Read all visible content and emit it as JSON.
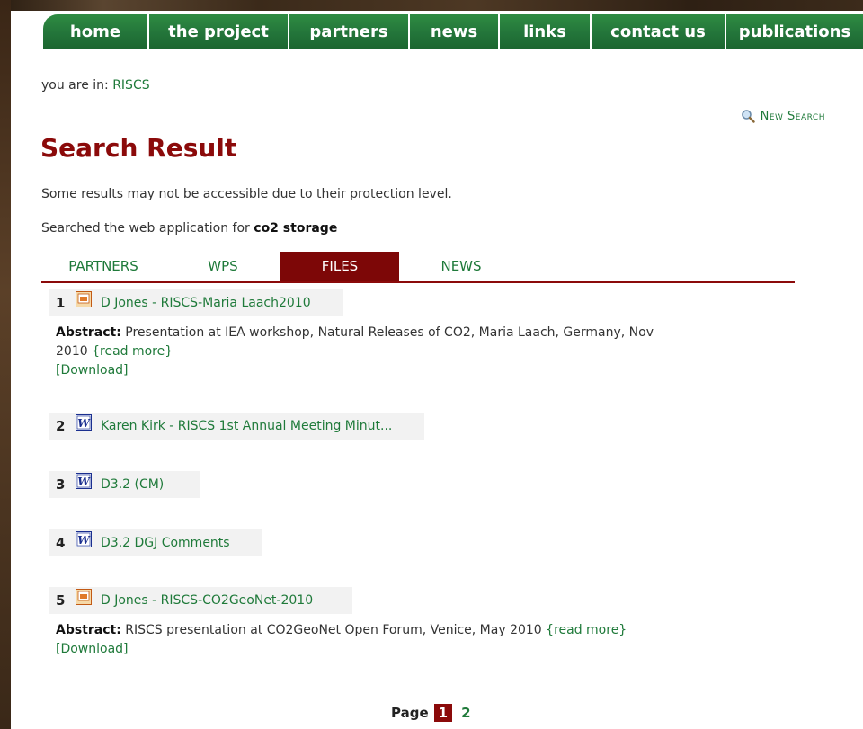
{
  "nav": {
    "items": [
      {
        "label": "home"
      },
      {
        "label": "the project"
      },
      {
        "label": "partners"
      },
      {
        "label": "news"
      },
      {
        "label": "links"
      },
      {
        "label": "contact us"
      },
      {
        "label": "publications"
      }
    ]
  },
  "breadcrumb": {
    "prefix": "you are in:",
    "link": "RISCS"
  },
  "new_search": {
    "label": "New Search"
  },
  "page_title": "Search Result",
  "notice": "Some results may not be accessible due to their protection level.",
  "searched": {
    "prefix": "Searched the web application for",
    "query": "co2 storage"
  },
  "tabs": [
    {
      "label": "PARTNERS",
      "active": false
    },
    {
      "label": "WPS",
      "active": false
    },
    {
      "label": "FILES",
      "active": true
    },
    {
      "label": "NEWS",
      "active": false
    }
  ],
  "results": [
    {
      "num": "1",
      "file_type": "powerpoint-icon",
      "title": "D Jones - RISCS-Maria Laach2010",
      "abstract_label": "Abstract:",
      "abstract": "Presentation at IEA workshop, Natural Releases of CO2, Maria Laach, Germany, Nov 2010",
      "read_more": "{read more}",
      "download": "[Download]"
    },
    {
      "num": "2",
      "file_type": "word-icon",
      "title": "Karen Kirk - RISCS 1st Annual Meeting Minut..."
    },
    {
      "num": "3",
      "file_type": "word-icon",
      "title": "D3.2 (CM)"
    },
    {
      "num": "4",
      "file_type": "word-icon",
      "title": "D3.2 DGJ Comments"
    },
    {
      "num": "5",
      "file_type": "powerpoint-icon",
      "title": "D Jones - RISCS-CO2GeoNet-2010",
      "abstract_label": "Abstract:",
      "abstract": "RISCS presentation at CO2GeoNet Open Forum, Venice, May 2010",
      "read_more": "{read more}",
      "download": "[Download]"
    }
  ],
  "pager": {
    "label": "Page",
    "current": "1",
    "pages": [
      "2"
    ]
  },
  "colors": {
    "nav_green": "#23753a",
    "link_green": "#1f7a3a",
    "title_red": "#8b0a0a",
    "tab_active": "#7d0707"
  }
}
